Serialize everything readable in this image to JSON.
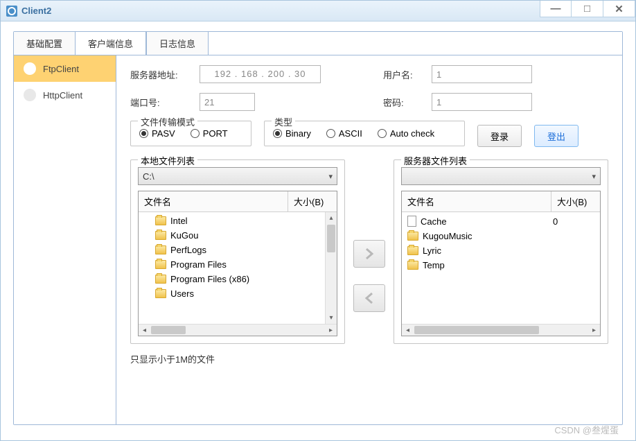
{
  "window": {
    "title": "Client2"
  },
  "tabs": {
    "t0": "基础配置",
    "t1": "客户端信息",
    "t2": "日志信息"
  },
  "sidebar": {
    "items": [
      "FtpClient",
      "HttpClient"
    ]
  },
  "form": {
    "server_label": "服务器地址:",
    "server_value": "192 . 168 . 200 .  30",
    "user_label": "用户名:",
    "user_value": "1",
    "port_label": "端口号:",
    "port_value": "21",
    "pass_label": "密码:",
    "pass_value": "1"
  },
  "mode": {
    "legend": "文件传输模式",
    "pasv": "PASV",
    "port": "PORT"
  },
  "type": {
    "legend": "类型",
    "binary": "Binary",
    "ascii": "ASCII",
    "auto": "Auto check"
  },
  "buttons": {
    "login": "登录",
    "logout": "登出"
  },
  "local": {
    "legend": "本地文件列表",
    "drive": "C:\\",
    "col_name": "文件名",
    "col_size": "大小(B)",
    "files": [
      "Intel",
      "KuGou",
      "PerfLogs",
      "Program Files",
      "Program Files (x86)",
      "Users"
    ]
  },
  "remote": {
    "legend": "服务器文件列表",
    "col_name": "文件名",
    "col_size": "大小(B)",
    "files": [
      {
        "name": "Cache",
        "size": "0",
        "type": "file"
      },
      {
        "name": "KugouMusic",
        "size": "",
        "type": "folder"
      },
      {
        "name": "Lyric",
        "size": "",
        "type": "folder"
      },
      {
        "name": "Temp",
        "size": "",
        "type": "folder"
      }
    ]
  },
  "footer": "只显示小于1M的文件",
  "watermark": "CSDN @叁煋蛋"
}
